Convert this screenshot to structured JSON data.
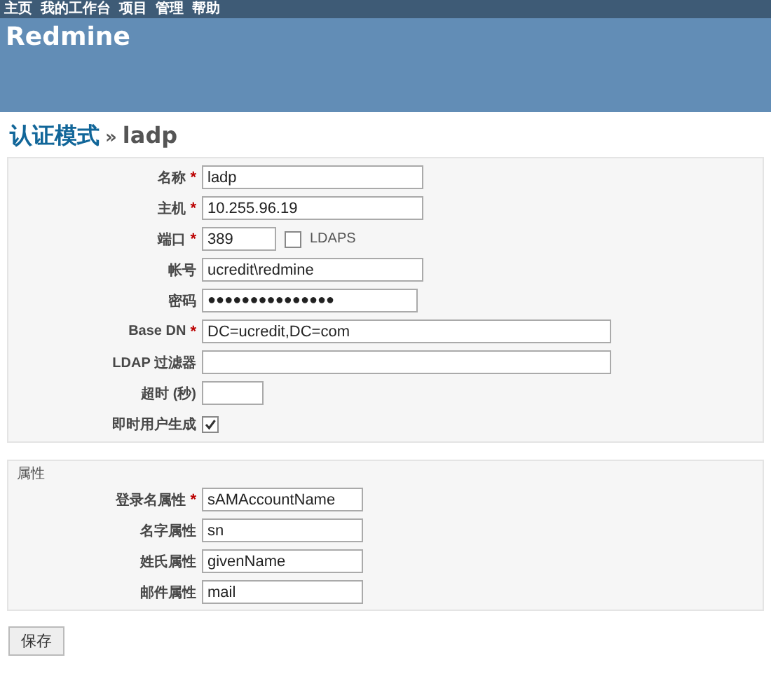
{
  "top_menu": [
    "主页",
    "我的工作台",
    "项目",
    "管理",
    "帮助"
  ],
  "header": {
    "title": "Redmine"
  },
  "heading": {
    "parent": "认证模式",
    "separator": "»",
    "current": "ladp"
  },
  "main_fields": [
    {
      "kind": "text",
      "label": "名称",
      "required_mark": "*",
      "value": "ladp"
    },
    {
      "kind": "text",
      "label": "主机",
      "required_mark": "*",
      "value": "10.255.96.19"
    },
    {
      "kind": "text",
      "label": "端口",
      "required_mark": "*",
      "value": "389",
      "extra_checkbox": {
        "label": "LDAPS",
        "checked": false
      }
    },
    {
      "kind": "text",
      "label": "帐号",
      "value": "ucredit\\redmine"
    },
    {
      "kind": "password",
      "label": "密码",
      "value": "●●●●●●●●●●●●●●●"
    },
    {
      "kind": "text",
      "label": "Base DN",
      "required_mark": "*",
      "value": "DC=ucredit,DC=com"
    },
    {
      "kind": "text",
      "label": "LDAP 过滤器"
    },
    {
      "kind": "text",
      "label": "超时 (秒)"
    },
    {
      "kind": "checkbox",
      "label": "即时用户生成",
      "checked": true
    }
  ],
  "attributes": {
    "legend": "属性",
    "fields": [
      {
        "label": "登录名属性",
        "required_mark": "*",
        "value": "sAMAccountName"
      },
      {
        "label": "名字属性",
        "value": "sn"
      },
      {
        "label": "姓氏属性",
        "value": "givenName"
      },
      {
        "label": "邮件属性",
        "value": "mail"
      }
    ]
  },
  "buttons": [
    "保存"
  ]
}
